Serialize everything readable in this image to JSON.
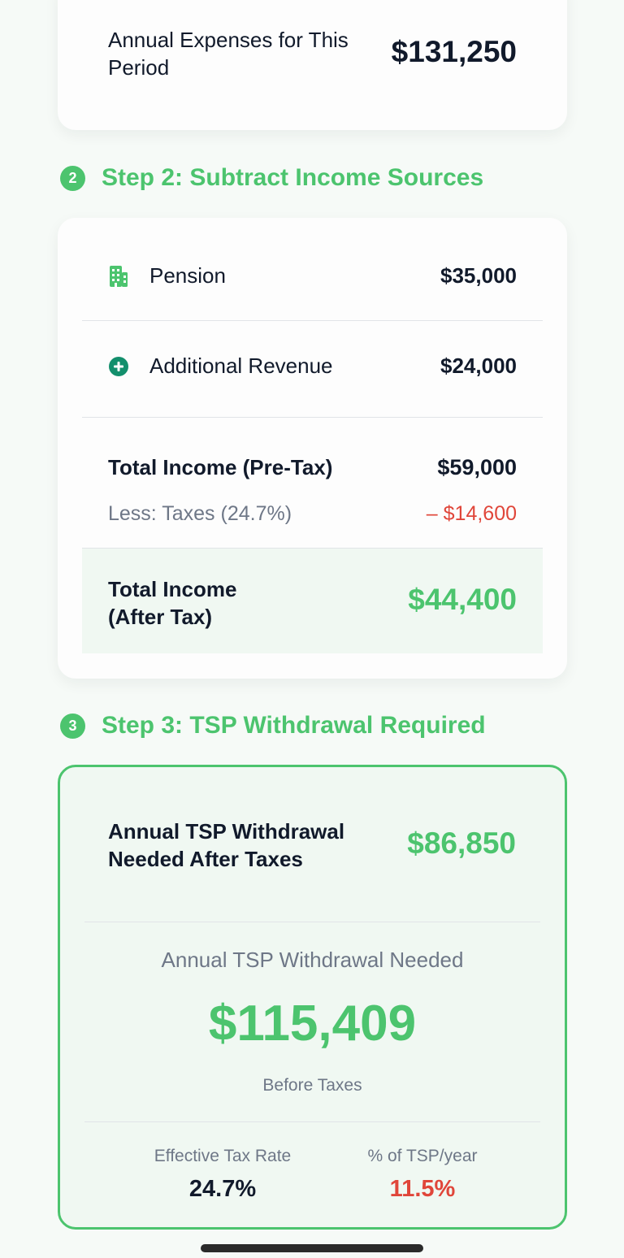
{
  "step1": {
    "expenses_label": "Annual Expenses for This Period",
    "expenses_value": "$131,250"
  },
  "step2": {
    "badge": "2",
    "title": "Step 2: Subtract Income Sources",
    "rows": [
      {
        "icon": "building-icon",
        "label": "Pension",
        "value": "$35,000"
      },
      {
        "icon": "plus-circle-icon",
        "label": "Additional Revenue",
        "value": "$24,000"
      }
    ],
    "total_pre_tax_label": "Total Income (Pre-Tax)",
    "total_pre_tax_value": "$59,000",
    "taxes_label": "Less: Taxes (24.7%)",
    "taxes_value": "– $14,600",
    "total_after_tax_label": "Total Income (After Tax)",
    "total_after_tax_value": "$44,400"
  },
  "step3": {
    "badge": "3",
    "title": "Step 3: TSP Withdrawal Required",
    "after_tax_label": "Annual TSP Withdrawal Needed After Taxes",
    "after_tax_value": "$86,850",
    "needed_label": "Annual TSP Withdrawal Needed",
    "needed_value": "$115,409",
    "needed_sub": "Before Taxes",
    "effective_tax_label": "Effective Tax Rate",
    "effective_tax_value": "24.7%",
    "pct_tsp_label": "% of TSP/year",
    "pct_tsp_value": "11.5%"
  },
  "colors": {
    "accent_green": "#4cc46e",
    "negative_red": "#e0463a",
    "text_dark": "#111a2b",
    "text_muted": "#6e7787"
  }
}
